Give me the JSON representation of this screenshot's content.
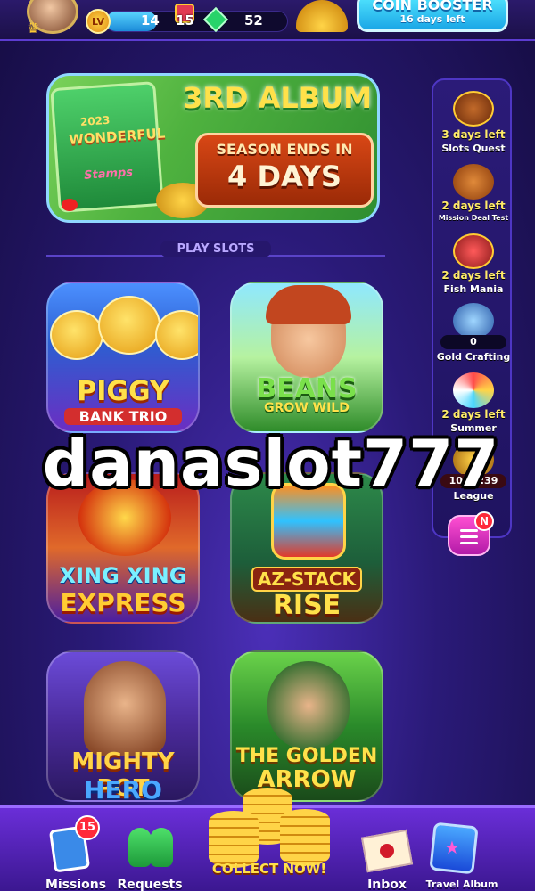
{
  "header": {
    "level": "14",
    "gifts": "15",
    "gems": "52",
    "booster_title": "COIN BOOSTER",
    "booster_subtitle": "16 days left",
    "level_badge": "LV"
  },
  "banner": {
    "book_year": "2023",
    "book_title": "WONDERFUL",
    "book_subtitle": "Stamps",
    "album_title": "3RD ALBUM",
    "season_line1": "SEASON ENDS IN",
    "season_line2": "4 DAYS"
  },
  "section": {
    "title": "PLAY SLOTS"
  },
  "games": [
    {
      "line1": "PIGGY",
      "line2": "BANK TRIO"
    },
    {
      "line1": "BEANS",
      "line2": "GROW WILD"
    },
    {
      "line1": "XING XING",
      "line2": "EXPRESS"
    },
    {
      "line1": "AZ-STACK",
      "line2": "RISE"
    },
    {
      "line1": "MIGHTY POT",
      "line2": "HERO"
    },
    {
      "line1": "THE GOLDEN",
      "line2": "ARROW"
    }
  ],
  "events": [
    {
      "time": "3 days left",
      "name": "Slots Quest"
    },
    {
      "time": "2 days left",
      "name": "Mission Deal Test"
    },
    {
      "time": "2 days left",
      "name": "Fish Mania"
    },
    {
      "counter": "0",
      "name": "Gold Crafting"
    },
    {
      "time": "2 days left",
      "name": "Summer Event"
    },
    {
      "counter": "10:09:39",
      "name": "League"
    }
  ],
  "menu": {
    "notification": "N"
  },
  "watermark": "danaslot777",
  "bottom_nav": {
    "missions": "Missions",
    "missions_badge": "15",
    "requests": "Requests",
    "collect": "COLLECT NOW!",
    "inbox": "Inbox",
    "travel_album": "Travel Album"
  },
  "colors": {
    "accent": "#6a2ed8",
    "booster": "#1aa6e6",
    "alert": "#ff2a3a"
  }
}
